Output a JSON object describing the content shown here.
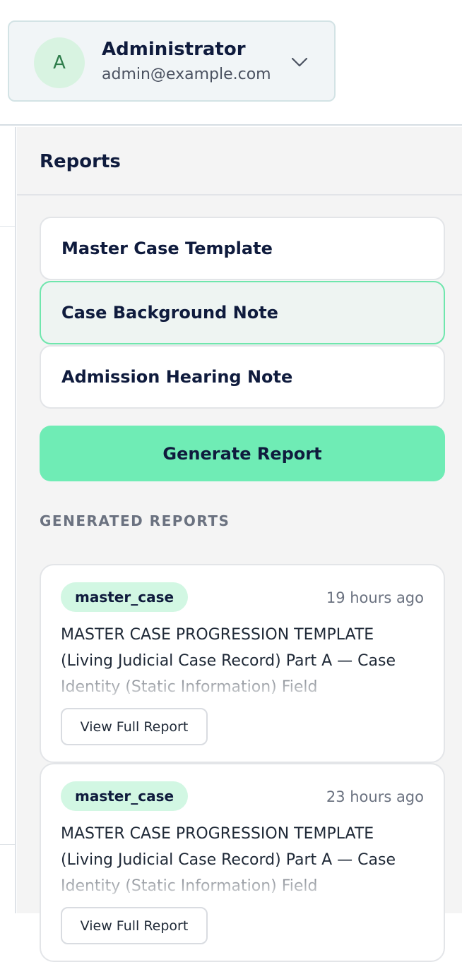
{
  "user": {
    "avatar_initial": "A",
    "name": "Administrator",
    "email": "admin@example.com"
  },
  "reports_panel": {
    "title": "Reports",
    "templates": [
      {
        "label": "Master Case Template",
        "selected": false
      },
      {
        "label": "Case Background Note",
        "selected": true
      },
      {
        "label": "Admission Hearing Note",
        "selected": false
      }
    ],
    "generate_label": "Generate Report",
    "generated_section_label": "GENERATED REPORTS",
    "generated_reports": [
      {
        "badge": "master_case",
        "time": "19 hours ago",
        "preview": "MASTER CASE PROGRESSION TEMPLATE (Living Judicial Case Record) Part A — Case Identity (Static Information) Field",
        "view_label": "View Full Report"
      },
      {
        "badge": "master_case",
        "time": "23 hours ago",
        "preview": "MASTER CASE PROGRESSION TEMPLATE (Living Judicial Case Record) Part A — Case Identity (Static Information) Field",
        "view_label": "View Full Report"
      }
    ]
  },
  "colors": {
    "accent": "#6fecb5",
    "selected_border": "#6fe6ad",
    "badge_bg": "#d2f7e3",
    "text_primary": "#0f1b3d"
  }
}
